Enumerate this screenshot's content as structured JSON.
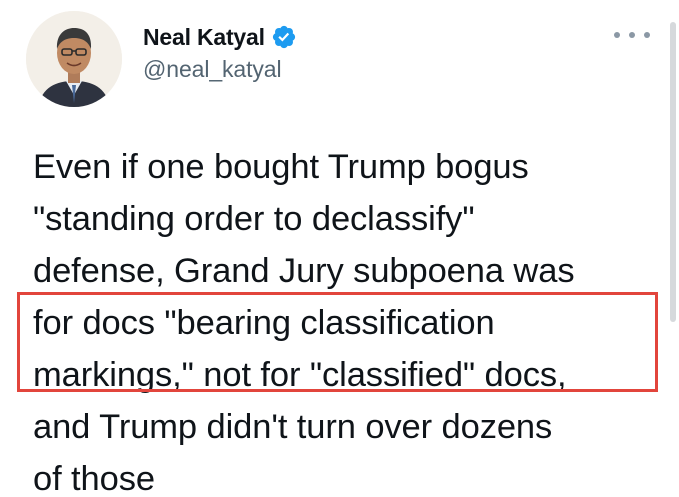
{
  "tweet": {
    "author": {
      "display_name": "Neal Katyal",
      "handle": "@neal_katyal",
      "verified": true,
      "avatar_icon": "avatar-portrait",
      "verified_icon": "verified-badge-icon"
    },
    "more_icon": "more-options-icon",
    "text_lines": [
      "Even if one bought Trump bogus",
      "\"standing order to declassify\"",
      "defense, Grand Jury subpoena was",
      "for docs \"bearing classification",
      "markings,\" not for \"classified\" docs,",
      "and Trump didn't turn over dozens",
      "of those"
    ],
    "highlight_color": "#e2453c",
    "verified_color": "#1d9bf0"
  }
}
